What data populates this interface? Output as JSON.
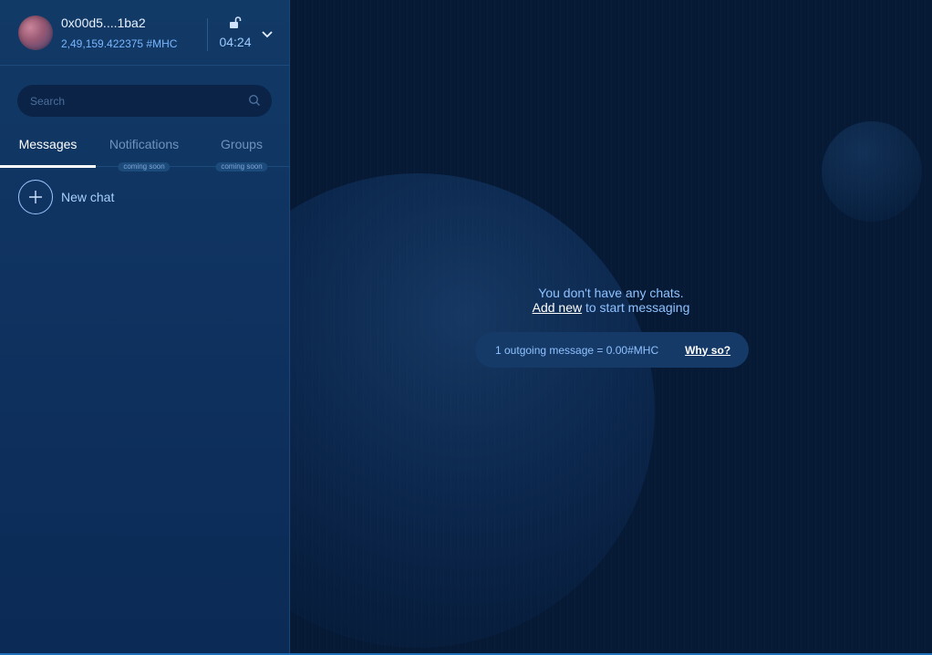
{
  "account": {
    "address": "0x00d5....1ba2",
    "balance": "2,49,159.422375 #MHC",
    "timer": "04:24"
  },
  "search": {
    "placeholder": "Search"
  },
  "tabs": [
    {
      "label": "Messages",
      "badge": ""
    },
    {
      "label": "Notifications",
      "badge": "coming soon"
    },
    {
      "label": "Groups",
      "badge": "coming soon"
    }
  ],
  "new_chat": {
    "label": "New chat"
  },
  "empty_state": {
    "line1": "You don't have any chats.",
    "add_new": "Add new",
    "line2_rest": " to start messaging"
  },
  "info_pill": {
    "text": "1 outgoing message = 0.00#MHC",
    "link": "Why so?"
  },
  "colors": {
    "sidebar_bg": "#0f3260",
    "main_bg": "#061a36",
    "accent": "#79b6ff"
  }
}
